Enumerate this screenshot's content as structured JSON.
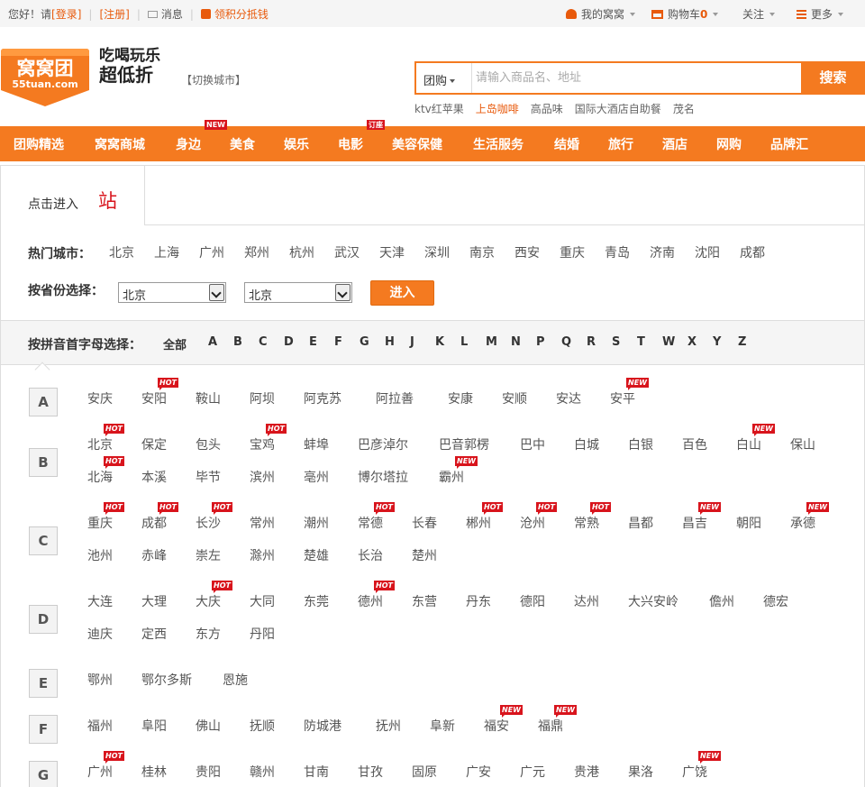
{
  "topbar": {
    "greeting": "您好！请",
    "login": "[登录]",
    "register": "[注册]",
    "messages": "消息",
    "points": "领积分抵钱",
    "my_account": "我的窝窝",
    "cart": "购物车",
    "cart_count": "0",
    "follow": "关注",
    "more": "更多"
  },
  "header": {
    "logo_main": "窝窝团",
    "logo_sub": "55tuan.com",
    "slogan_line1": "吃喝玩乐",
    "slogan_line2": "超低折",
    "switch_city": "【切换城市】"
  },
  "search": {
    "category": "团购",
    "placeholder": "请输入商品名、地址",
    "button": "搜索",
    "hotwords": [
      "ktv红苹果",
      "上岛咖啡",
      "高品味",
      "国际大酒店自助餐",
      "茂名"
    ],
    "highlight_index": 1
  },
  "nav": {
    "items": [
      "团购精选",
      "窝窝商城",
      "身边",
      "美食",
      "娱乐",
      "电影",
      "美容保健",
      "生活服务",
      "结婚",
      "旅行",
      "酒店",
      "网购",
      "品牌汇"
    ],
    "badges": [
      {
        "index": 2,
        "text": "NEW"
      },
      {
        "index": 5,
        "text": "订座"
      }
    ]
  },
  "panel": {
    "tab_text": "点击进入",
    "tab_site": "站",
    "hot_label": "热门城市：",
    "hot_cities": [
      "北京",
      "上海",
      "广州",
      "郑州",
      "杭州",
      "武汉",
      "天津",
      "深圳",
      "南京",
      "西安",
      "重庆",
      "青岛",
      "济南",
      "沈阳",
      "成都"
    ],
    "province_label": "按省份选择：",
    "province_value": "北京",
    "city_value": "北京",
    "enter_button": "进入",
    "letter_label": "按拼音首字母选择：",
    "letters": [
      "全部",
      "A",
      "B",
      "C",
      "D",
      "E",
      "F",
      "G",
      "H",
      "J",
      "K",
      "L",
      "M",
      "N",
      "P",
      "Q",
      "R",
      "S",
      "T",
      "W",
      "X",
      "Y",
      "Z"
    ]
  },
  "groups": [
    {
      "letter": "A",
      "rows": [
        [
          {
            "n": "安庆"
          },
          {
            "n": "安阳",
            "t": "HOT"
          },
          {
            "n": "鞍山"
          },
          {
            "n": "阿坝"
          },
          {
            "n": "阿克苏"
          },
          {
            "n": "阿拉善"
          },
          {
            "n": "安康"
          },
          {
            "n": "安顺"
          },
          {
            "n": "安达"
          },
          {
            "n": "安平",
            "t": "NEW"
          }
        ]
      ]
    },
    {
      "letter": "B",
      "rows": [
        [
          {
            "n": "北京",
            "t": "HOT"
          },
          {
            "n": "保定"
          },
          {
            "n": "包头"
          },
          {
            "n": "宝鸡",
            "t": "HOT"
          },
          {
            "n": "蚌埠"
          },
          {
            "n": "巴彦淖尔"
          },
          {
            "n": "巴音郭楞"
          },
          {
            "n": "巴中"
          },
          {
            "n": "白城"
          },
          {
            "n": "白银"
          },
          {
            "n": "百色"
          },
          {
            "n": "白山",
            "t": "NEW"
          },
          {
            "n": "保山"
          }
        ],
        [
          {
            "n": "北海",
            "t": "HOT"
          },
          {
            "n": "本溪"
          },
          {
            "n": "毕节"
          },
          {
            "n": "滨州"
          },
          {
            "n": "亳州"
          },
          {
            "n": "博尔塔拉"
          },
          {
            "n": "霸州",
            "t": "NEW"
          }
        ]
      ]
    },
    {
      "letter": "C",
      "rows": [
        [
          {
            "n": "重庆",
            "t": "HOT"
          },
          {
            "n": "成都",
            "t": "HOT"
          },
          {
            "n": "长沙",
            "t": "HOT"
          },
          {
            "n": "常州"
          },
          {
            "n": "潮州"
          },
          {
            "n": "常德",
            "t": "HOT"
          },
          {
            "n": "长春"
          },
          {
            "n": "郴州",
            "t": "HOT"
          },
          {
            "n": "沧州",
            "t": "HOT"
          },
          {
            "n": "常熟",
            "t": "HOT"
          },
          {
            "n": "昌都"
          },
          {
            "n": "昌吉",
            "t": "NEW"
          },
          {
            "n": "朝阳"
          },
          {
            "n": "承德",
            "t": "NEW"
          }
        ],
        [
          {
            "n": "池州"
          },
          {
            "n": "赤峰"
          },
          {
            "n": "崇左"
          },
          {
            "n": "滁州"
          },
          {
            "n": "楚雄"
          },
          {
            "n": "长治"
          },
          {
            "n": "楚州"
          }
        ]
      ]
    },
    {
      "letter": "D",
      "rows": [
        [
          {
            "n": "大连"
          },
          {
            "n": "大理"
          },
          {
            "n": "大庆",
            "t": "HOT"
          },
          {
            "n": "大同"
          },
          {
            "n": "东莞"
          },
          {
            "n": "德州",
            "t": "HOT"
          },
          {
            "n": "东营"
          },
          {
            "n": "丹东"
          },
          {
            "n": "德阳"
          },
          {
            "n": "达州"
          },
          {
            "n": "大兴安岭"
          },
          {
            "n": "儋州"
          },
          {
            "n": "德宏"
          }
        ],
        [
          {
            "n": "迪庆"
          },
          {
            "n": "定西"
          },
          {
            "n": "东方"
          },
          {
            "n": "丹阳"
          }
        ]
      ]
    },
    {
      "letter": "E",
      "rows": [
        [
          {
            "n": "鄂州"
          },
          {
            "n": "鄂尔多斯"
          },
          {
            "n": "恩施"
          }
        ]
      ]
    },
    {
      "letter": "F",
      "rows": [
        [
          {
            "n": "福州"
          },
          {
            "n": "阜阳"
          },
          {
            "n": "佛山"
          },
          {
            "n": "抚顺"
          },
          {
            "n": "防城港"
          },
          {
            "n": "抚州"
          },
          {
            "n": "阜新"
          },
          {
            "n": "福安",
            "t": "NEW"
          },
          {
            "n": "福鼎",
            "t": "NEW"
          }
        ]
      ]
    },
    {
      "letter": "G",
      "rows": [
        [
          {
            "n": "广州",
            "t": "HOT"
          },
          {
            "n": "桂林"
          },
          {
            "n": "贵阳"
          },
          {
            "n": "赣州"
          },
          {
            "n": "甘南"
          },
          {
            "n": "甘孜"
          },
          {
            "n": "固原"
          },
          {
            "n": "广安"
          },
          {
            "n": "广元"
          },
          {
            "n": "贵港"
          },
          {
            "n": "果洛"
          },
          {
            "n": "广饶",
            "t": "NEW"
          }
        ]
      ]
    }
  ]
}
